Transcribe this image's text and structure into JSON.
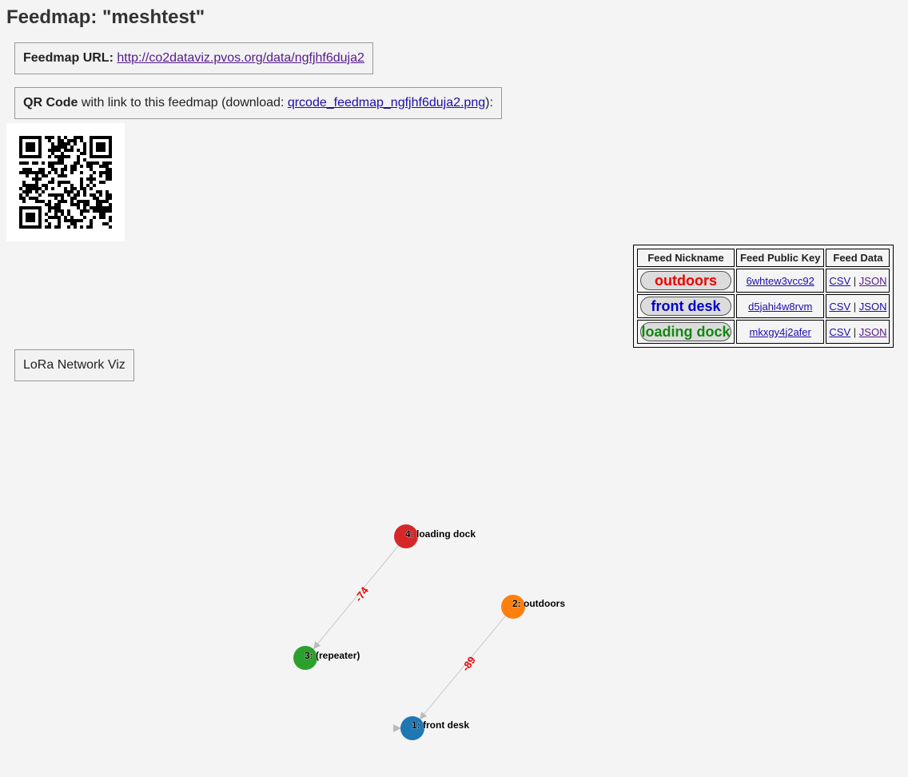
{
  "page": {
    "title": "Feedmap: \"meshtest\""
  },
  "feedmap_url": {
    "label": "Feedmap URL:",
    "link_text": "http://co2dataviz.pvos.org/data/ngfjhf6duja2"
  },
  "qr": {
    "label": "QR Code",
    "text_before": " with link to this feedmap (download: ",
    "link_text": "qrcode_feedmap_ngfjhf6duja2.png",
    "text_after": "):"
  },
  "feed_table": {
    "headers": [
      "Feed Nickname",
      "Feed Public Key",
      "Feed Data"
    ],
    "rows": [
      {
        "nickname": "outdoors",
        "color": "#ee0000",
        "key": "6whtew3vcc92",
        "csv": "CSV",
        "json": "JSON",
        "sep": "|"
      },
      {
        "nickname": "front desk",
        "color": "#0000cc",
        "key": "d5jahi4w8rvm",
        "csv": "CSV",
        "json": "JSON",
        "sep": "|"
      },
      {
        "nickname": "loading dock",
        "color": "#118811",
        "key": "mkxgy4j2afer",
        "csv": "CSV",
        "json": "JSON",
        "sep": "|"
      }
    ]
  },
  "lora_button": {
    "label": "LoRa Network Viz"
  },
  "network": {
    "nodes": [
      {
        "id": "4",
        "label": "4: loading dock",
        "color": "#d62728"
      },
      {
        "id": "2",
        "label": "2: outdoors",
        "color": "#ff7f0e"
      },
      {
        "id": "3",
        "label": "3: (repeater)",
        "color": "#2ca02c"
      },
      {
        "id": "1",
        "label": "1: front desk",
        "color": "#1f77b4"
      }
    ],
    "edges": [
      {
        "from": "4",
        "to": "3",
        "label": "-74"
      },
      {
        "from": "2",
        "to": "1",
        "label": "-89"
      }
    ],
    "label_color": "#ee0000"
  }
}
